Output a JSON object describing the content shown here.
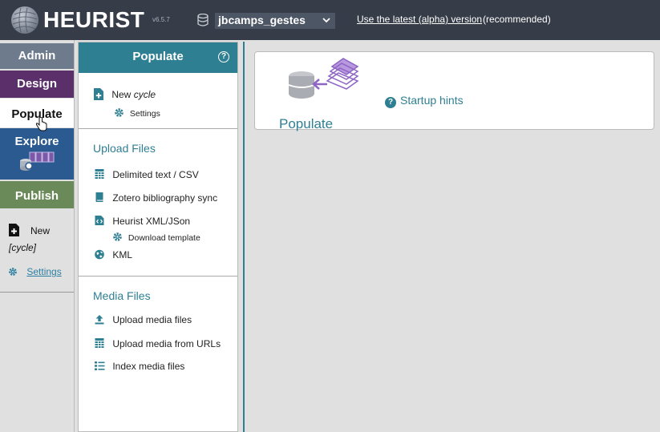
{
  "header": {
    "app_name": "HEURIST",
    "version": "v6.5.7",
    "database": "jbcamps_gestes",
    "alpha_link": "Use the latest (alpha) version",
    "alpha_note": "(recommended)"
  },
  "nav": {
    "admin": "Admin",
    "design": "Design",
    "populate": "Populate",
    "explore": "Explore",
    "publish": "Publish"
  },
  "quick": {
    "new_label": "New",
    "new_type": "[cycle]",
    "settings": "Settings"
  },
  "panel": {
    "title": "Populate",
    "help": "?",
    "new_prefix": "New ",
    "new_type": "cycle",
    "new_settings": "Settings",
    "upload_title": "Upload Files",
    "upload_items": [
      "Delimited text / CSV",
      "Zotero bibliography sync",
      "Heurist XML/JSon"
    ],
    "download_template": "Download template",
    "kml": "KML",
    "media_title": "Media Files",
    "media_items": [
      "Upload media files",
      "Upload media from URLs",
      "Index media files"
    ]
  },
  "main": {
    "card_title": "Populate",
    "hints": "Startup hints"
  },
  "colors": {
    "header_bg": "#363d48",
    "admin": "#6e7b8c",
    "design": "#5b2f6a",
    "explore": "#2a5a8f",
    "publish": "#6b8a5a",
    "accent": "#2f7f93"
  }
}
